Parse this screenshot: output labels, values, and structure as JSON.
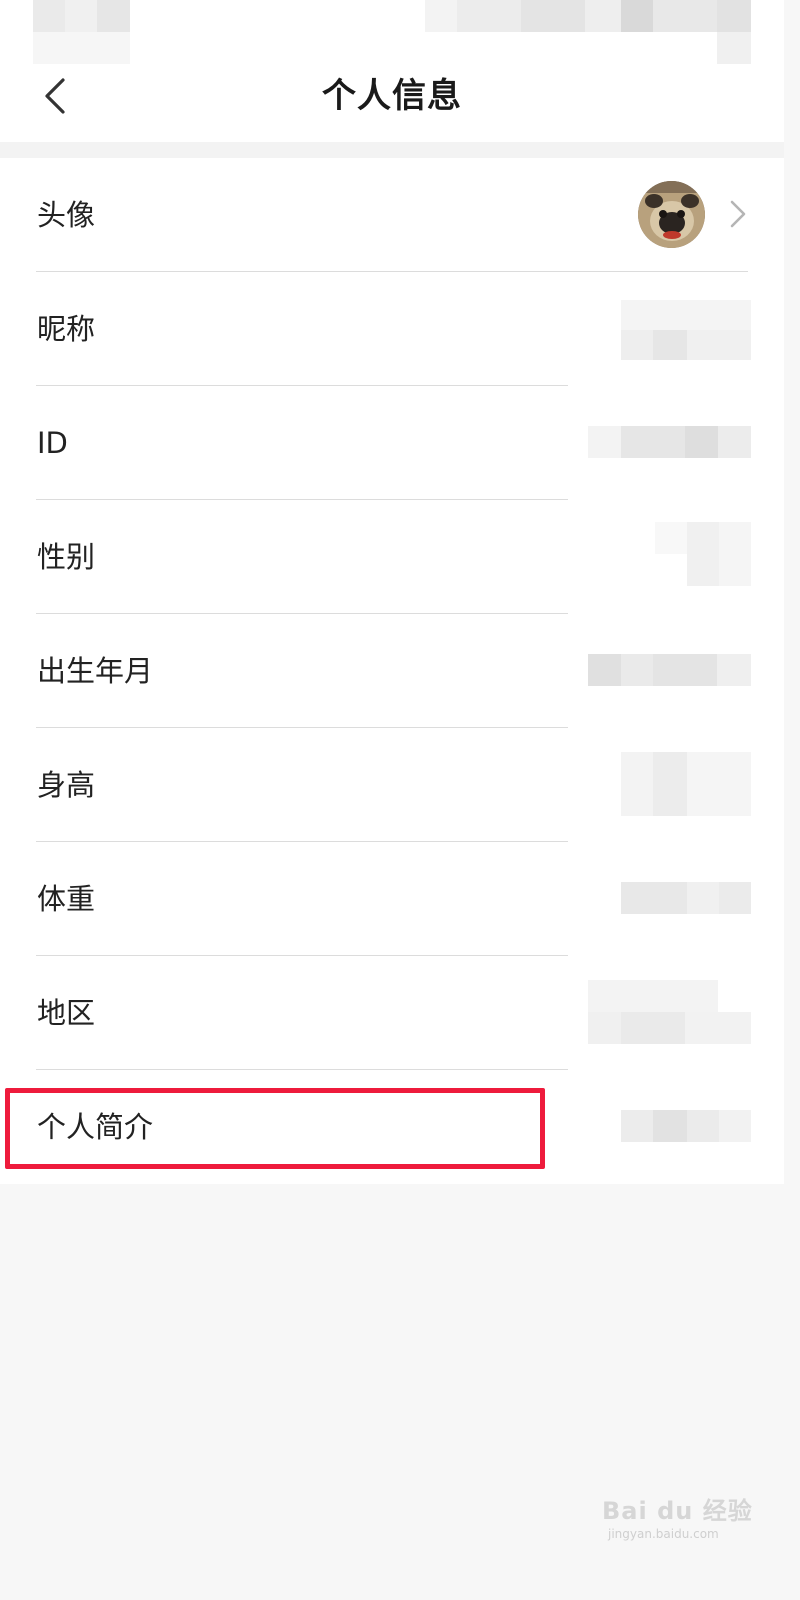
{
  "header": {
    "title": "个人信息"
  },
  "rows": [
    {
      "label": "头像",
      "type": "avatar"
    },
    {
      "label": "昵称",
      "type": "blurred"
    },
    {
      "label": "ID",
      "type": "blurred"
    },
    {
      "label": "性别",
      "type": "blurred"
    },
    {
      "label": "出生年月",
      "type": "blurred"
    },
    {
      "label": "身高",
      "type": "blurred"
    },
    {
      "label": "体重",
      "type": "blurred"
    },
    {
      "label": "地区",
      "type": "blurred"
    },
    {
      "label": "个人简介",
      "type": "blurred",
      "highlighted": true
    }
  ],
  "colors": {
    "highlight": "#ee1b3c",
    "background": "#f7f7f7",
    "row_background": "#ffffff",
    "divider": "#dcdcdc"
  },
  "watermark": {
    "main": "Bai du 经验",
    "sub": "jingyan.baidu.com"
  }
}
